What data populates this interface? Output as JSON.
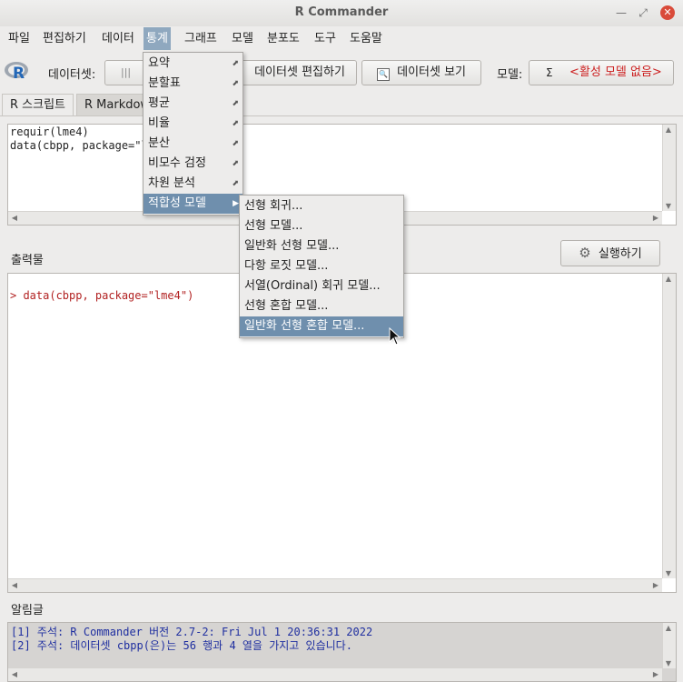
{
  "window": {
    "title": "R Commander"
  },
  "menubar": [
    "파일",
    "편집하기",
    "데이터",
    "통계",
    "그래프",
    "모델",
    "분포도",
    "도구",
    "도움말"
  ],
  "toolbar": {
    "dataset_label": "데이터셋:",
    "dataset_value": "",
    "edit_dataset": "데이터셋 편집하기",
    "view_dataset": "데이터셋 보기",
    "model_label": "모델:",
    "model_sigma": "Σ",
    "model_value": "<활성 모델 없음>"
  },
  "tabs": [
    "R 스크립트",
    "R Markdown"
  ],
  "script": {
    "lines": [
      "requir(lme4)",
      "data(cbpp, package=\"lme4\")"
    ]
  },
  "output": {
    "label": "출력물",
    "run_button": "실행하기",
    "lines": [
      "> data(cbpp, package=\"lme4\")"
    ]
  },
  "messages": {
    "label": "알림글",
    "lines": [
      "[1] 주석: R Commander 버전 2.7-2: Fri Jul 1 20:36:31 2022",
      "[2] 주석: 데이터셋 cbpp(은)는 56 행과 4 열을 가지고 있습니다."
    ]
  },
  "stats_menu": [
    "요약",
    "분할표",
    "평균",
    "비율",
    "분산",
    "비모수 검정",
    "차원 분석",
    "적합성 모델"
  ],
  "fit_menu": [
    "선형 회귀...",
    "선형 모델...",
    "일반화 선형 모델...",
    "다항 로짓 모델...",
    "서열(Ordinal) 회귀 모델...",
    "선형 혼합 모델...",
    "일반화 선형 혼합 모델..."
  ],
  "colors": {
    "accent": "#6f8fad",
    "model_text": "#cc1f1f",
    "output_red": "#b22222",
    "message_blue": "#1f2fa0"
  }
}
